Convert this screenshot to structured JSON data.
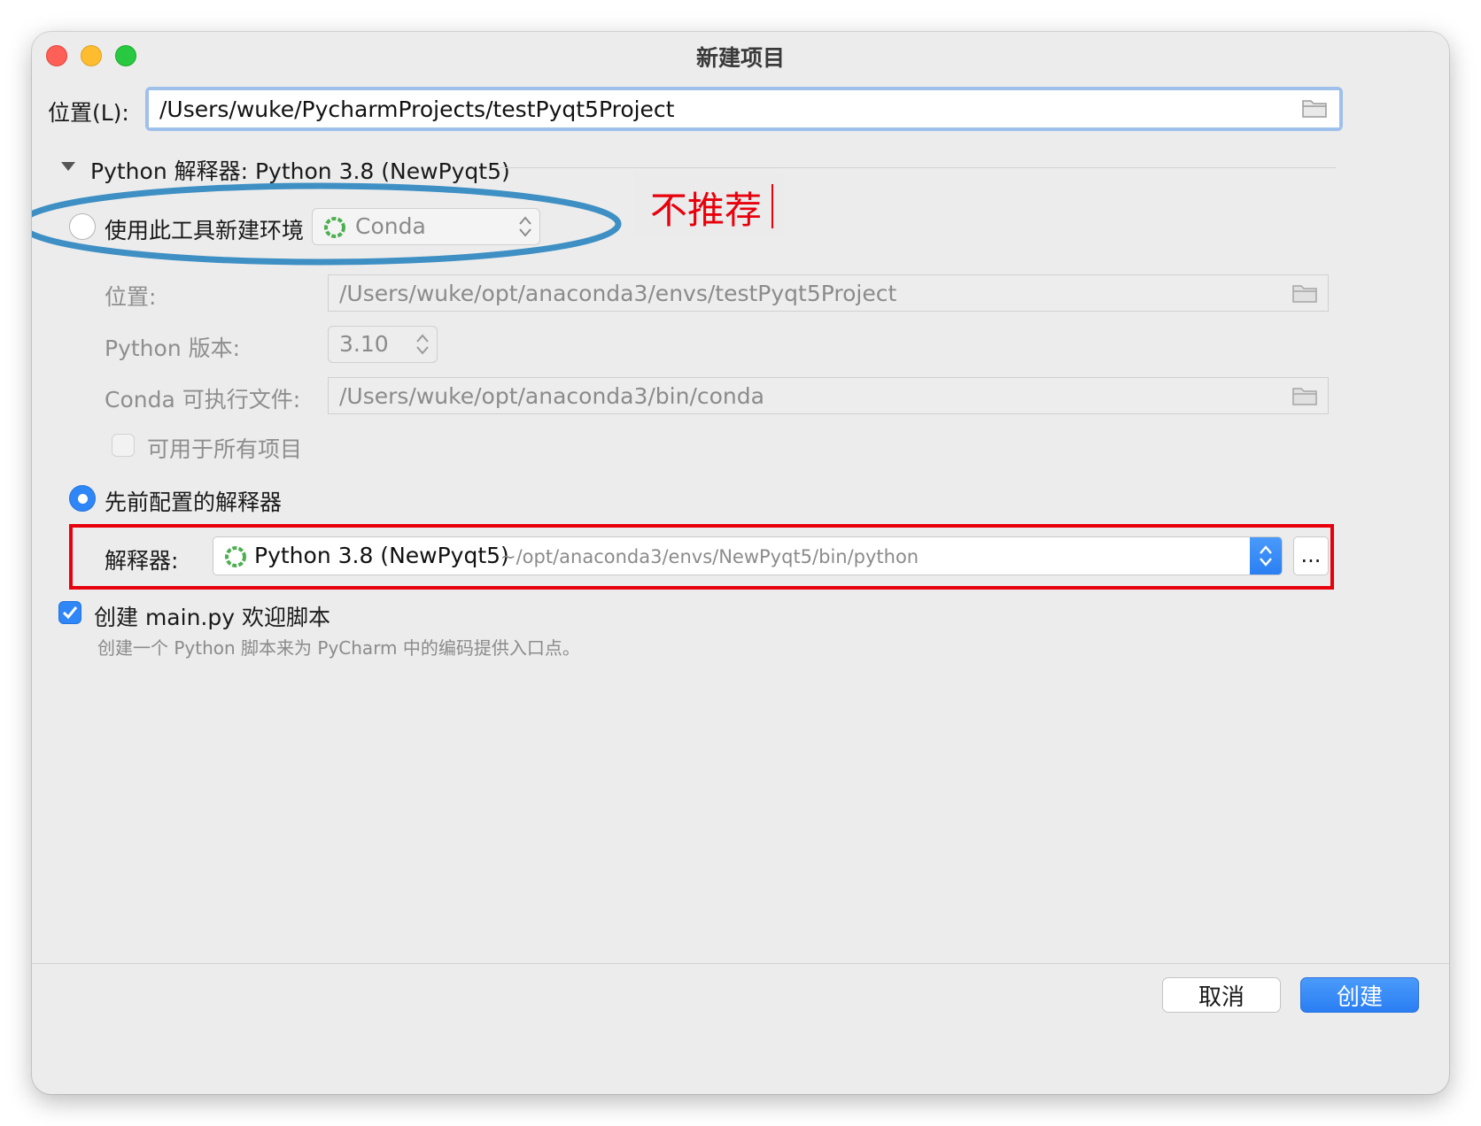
{
  "window": {
    "title": "新建项目"
  },
  "location": {
    "label": "位置(L):",
    "value": "/Users/wuke/PycharmProjects/testPyqt5Project"
  },
  "interpreter_section": {
    "header": "Python 解释器: Python 3.8 (NewPyqt5)"
  },
  "new_env": {
    "radio_label": "使用此工具新建环境",
    "tool_value": "Conda",
    "location_label": "位置:",
    "location_value": "/Users/wuke/opt/anaconda3/envs/testPyqt5Project",
    "python_version_label": "Python 版本:",
    "python_version_value": "3.10",
    "conda_exec_label": "Conda 可执行文件:",
    "conda_exec_value": "/Users/wuke/opt/anaconda3/bin/conda",
    "available_all_label": "可用于所有项目",
    "selected": false
  },
  "annotations": {
    "not_recommended": "不推荐",
    "ellipse_color": "#3d8fc4",
    "rect_color": "#e8000d"
  },
  "existing_env": {
    "radio_label": "先前配置的解释器",
    "selected": true,
    "interpreter_label": "解释器:",
    "interpreter_name": "Python 3.8 (NewPyqt5)",
    "interpreter_path": "~/opt/anaconda3/envs/NewPyqt5/bin/python",
    "more_button": "..."
  },
  "main_script": {
    "checkbox_label": "创建 main.py 欢迎脚本",
    "checked": true,
    "description": "创建一个 Python 脚本来为 PyCharm 中的编码提供入口点。"
  },
  "footer": {
    "cancel_label": "取消",
    "create_label": "创建"
  },
  "colors": {
    "accent": "#2f86f6",
    "conda_green": "#4caf50"
  }
}
